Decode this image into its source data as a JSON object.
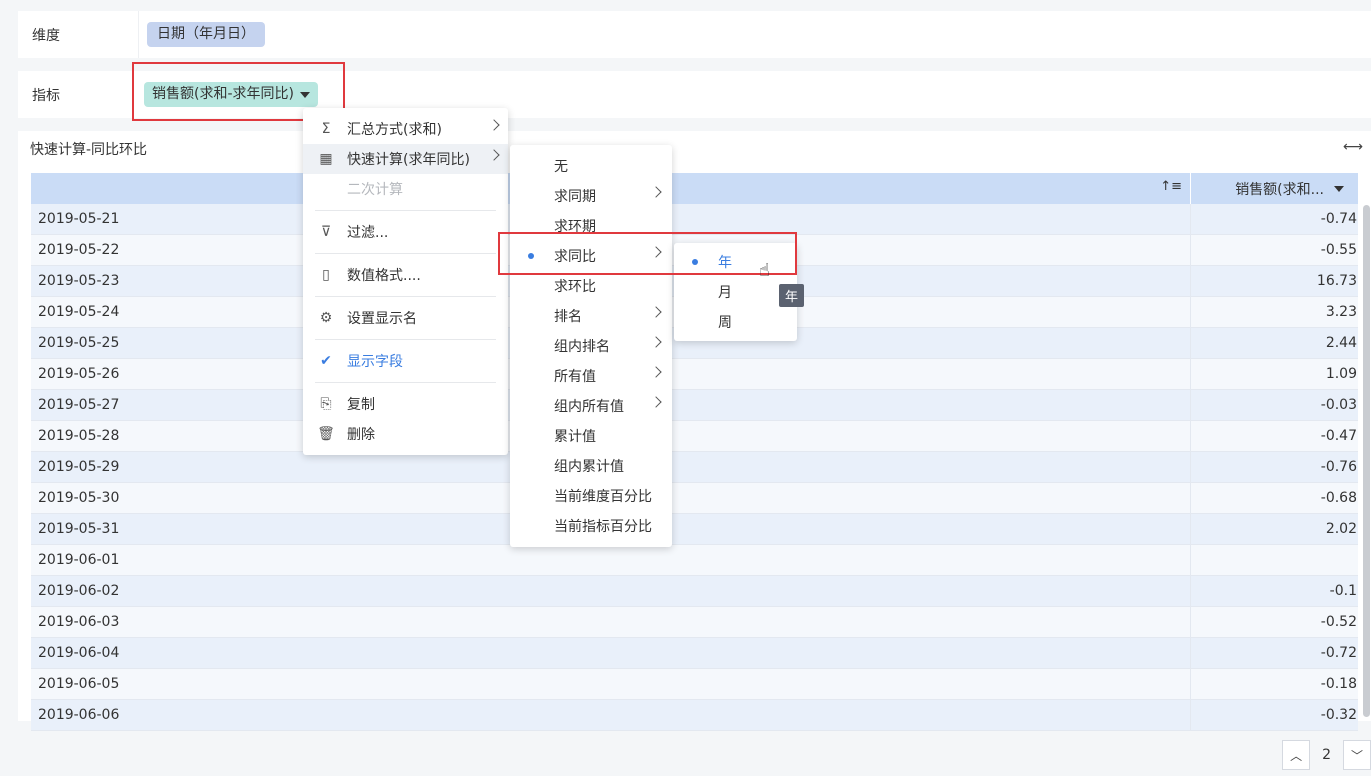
{
  "dimension": {
    "label": "维度",
    "pill": "日期（年月日）"
  },
  "measure": {
    "label": "指标",
    "pill": "销售额(求和-求年同比)"
  },
  "table": {
    "title": "快速计算-同比环比",
    "fit_icon": "fit-width-icon",
    "sort_icon": "sort-icon",
    "value_header": "销售额(求和...",
    "rows": [
      {
        "date": "2019-05-21",
        "value": "-0.74"
      },
      {
        "date": "2019-05-22",
        "value": "-0.55"
      },
      {
        "date": "2019-05-23",
        "value": "16.73"
      },
      {
        "date": "2019-05-24",
        "value": "3.23"
      },
      {
        "date": "2019-05-25",
        "value": "2.44"
      },
      {
        "date": "2019-05-26",
        "value": "1.09"
      },
      {
        "date": "2019-05-27",
        "value": "-0.03"
      },
      {
        "date": "2019-05-28",
        "value": "-0.47"
      },
      {
        "date": "2019-05-29",
        "value": "-0.76"
      },
      {
        "date": "2019-05-30",
        "value": "-0.68"
      },
      {
        "date": "2019-05-31",
        "value": "2.02"
      },
      {
        "date": "2019-06-01",
        "value": ""
      },
      {
        "date": "2019-06-02",
        "value": "-0.1"
      },
      {
        "date": "2019-06-03",
        "value": "-0.52"
      },
      {
        "date": "2019-06-04",
        "value": "-0.72"
      },
      {
        "date": "2019-06-05",
        "value": "-0.18"
      },
      {
        "date": "2019-06-06",
        "value": "-0.32"
      }
    ]
  },
  "pager": {
    "page": "2"
  },
  "menu1": {
    "items": [
      {
        "label": "汇总方式(求和)",
        "icon": "sigma-icon",
        "glyph": "Σ"
      },
      {
        "label": "快速计算(求年同比)",
        "icon": "quick-calc-icon",
        "glyph": "▦"
      },
      {
        "label": "二次计算"
      },
      {
        "label": "过滤...",
        "icon": "filter-icon",
        "glyph": "⊽"
      },
      {
        "label": "数值格式....",
        "icon": "number-format-icon",
        "glyph": "▯"
      },
      {
        "label": "设置显示名",
        "icon": "gear-icon",
        "glyph": "⚙"
      },
      {
        "label": "显示字段",
        "icon": "check-icon",
        "glyph": "✔"
      },
      {
        "label": "复制",
        "icon": "copy-icon",
        "glyph": "⎘"
      },
      {
        "label": "删除",
        "icon": "trash-icon",
        "glyph": "🗑"
      }
    ]
  },
  "menu2": {
    "items": [
      "无",
      "求同期",
      "求环期",
      "求同比",
      "求环比",
      "排名",
      "组内排名",
      "所有值",
      "组内所有值",
      "累计值",
      "组内累计值",
      "当前维度百分比",
      "当前指标百分比"
    ]
  },
  "menu3": {
    "items": [
      "年",
      "月",
      "周"
    ]
  },
  "tooltip": "年",
  "colors": {
    "accent": "#3a7de0",
    "highlight": "#e0393e",
    "dim_pill": "#c5d3ef",
    "measure_pill": "#b7e6df",
    "header": "#cadcf6"
  }
}
